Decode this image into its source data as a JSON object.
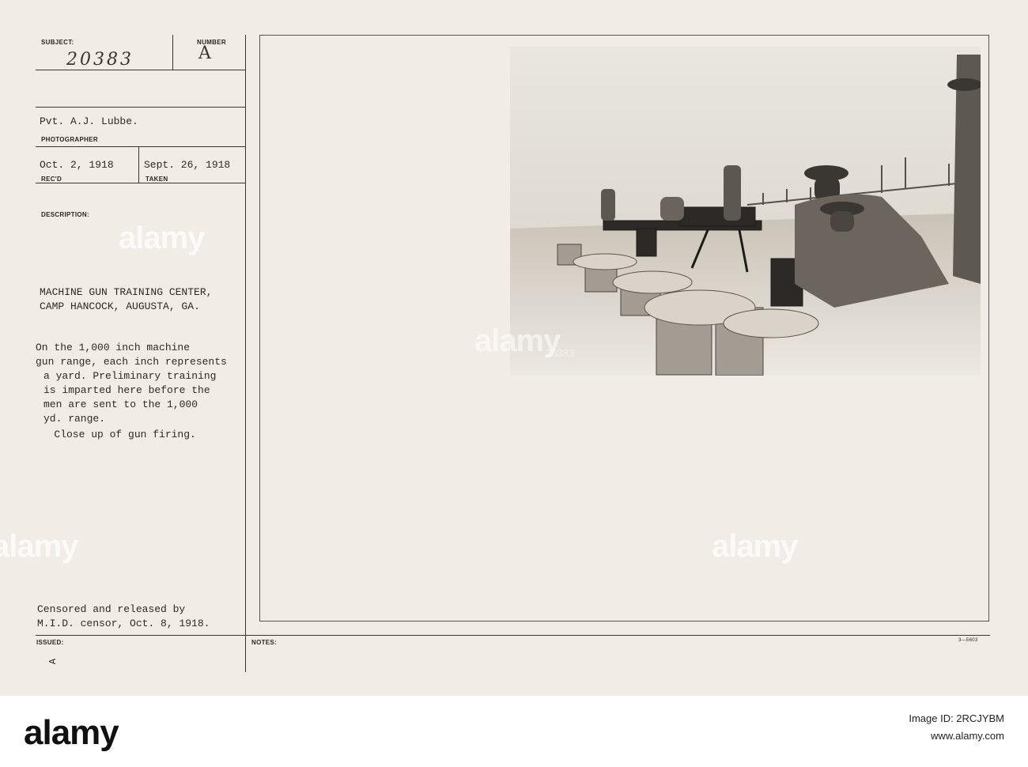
{
  "card": {
    "subject_label": "SUBJECT:",
    "subject_value": "20383",
    "number_label": "NUMBER",
    "number_value": "A",
    "photographer_name": "Pvt. A.J. Lubbe.",
    "photographer_label": "PHOTOGRAPHER",
    "recd_date": "Oct. 2, 1918",
    "recd_label": "REC'D",
    "taken_date": "Sept. 26, 1918",
    "taken_label": "TAKEN",
    "description_label": "DESCRIPTION:",
    "location_lines": [
      "MACHINE GUN TRAINING CENTER,",
      "CAMP HANCOCK, AUGUSTA, GA."
    ],
    "description_lines": [
      "On the 1,000 inch machine",
      "gun range, each inch represents",
      "a yard. Preliminary training",
      "is imparted here before the",
      "men are sent to the 1,000",
      "yd. range.",
      "   Close up of gun firing."
    ],
    "censor_lines": [
      "Censored and released by",
      "M.I.D. censor, Oct. 8, 1918."
    ],
    "issued_label": "ISSUED:",
    "issued_mark": "A",
    "notes_label": "NOTES:",
    "form_number": "3—5603",
    "photo_number": "20383"
  },
  "watermark": {
    "text": "alamy"
  },
  "footer": {
    "logo": "alamy",
    "image_id_line": "Image ID: 2RCJYBM",
    "site_line": "www.alamy.com"
  }
}
